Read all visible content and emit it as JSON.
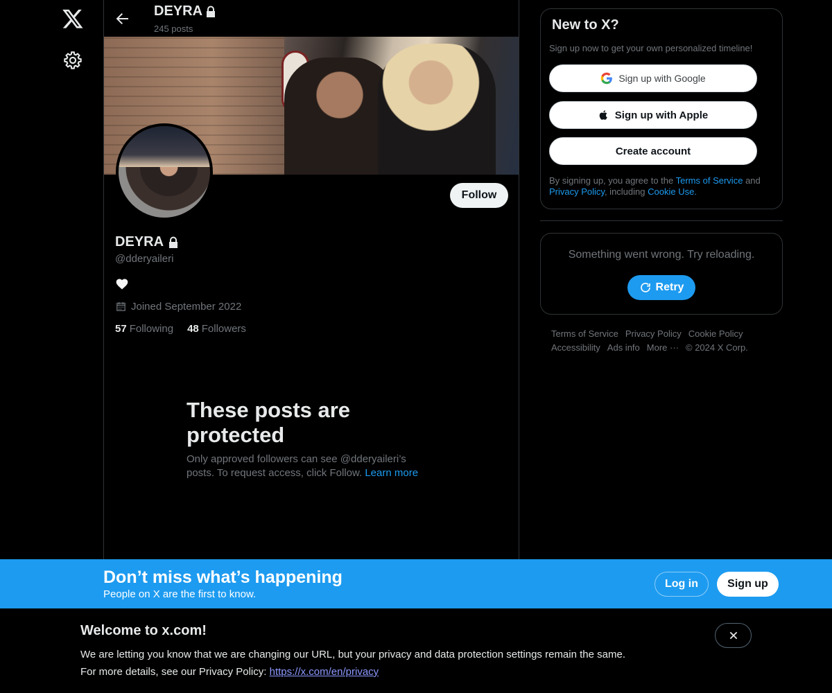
{
  "profile": {
    "name": "DEYRA",
    "post_count": "245 posts",
    "handle": "@dderyaileri",
    "joined": "Joined September 2022",
    "following_count": "57",
    "following_label": "Following",
    "followers_count": "48",
    "followers_label": "Followers",
    "follow_label": "Follow"
  },
  "protected": {
    "title": "These posts are protected",
    "text": "Only approved followers can see @dderyaileri’s posts. To request access, click Follow.",
    "learn_more": "Learn more"
  },
  "signup_card": {
    "title": "New to X?",
    "subtitle": "Sign up now to get your own personalized timeline!",
    "google": "Sign up with Google",
    "apple": "Sign up with Apple",
    "create": "Create account",
    "legal_prefix": "By signing up, you agree to the",
    "terms": "Terms of Service",
    "and": "and",
    "privacy": "Privacy Policy",
    "including": ", including",
    "cookie": "Cookie Use."
  },
  "error_card": {
    "message": "Something went wrong. Try reloading.",
    "retry": "Retry"
  },
  "footer": {
    "links": [
      "Terms of Service",
      "Privacy Policy",
      "Cookie Policy",
      "Accessibility",
      "Ads info",
      "More ···",
      "© 2024 X Corp."
    ]
  },
  "bottom_bar": {
    "title": "Don’t miss what’s happening",
    "subtitle": "People on X are the first to know.",
    "login": "Log in",
    "signup": "Sign up"
  },
  "notice": {
    "title": "Welcome to x.com!",
    "line1": "We are letting you know that we are changing our URL, but your privacy and data protection settings remain the same.",
    "line2_prefix": "For more details, see our Privacy Policy:",
    "link": "https://x.com/en/privacy"
  },
  "colors": {
    "accent": "#1d9bf0",
    "background": "#000000",
    "muted": "#71767b"
  },
  "icons": [
    "x-logo-icon",
    "gear-icon",
    "back-arrow-icon",
    "lock-icon",
    "heart-icon",
    "calendar-icon",
    "google-icon",
    "apple-icon",
    "refresh-icon",
    "close-icon"
  ]
}
